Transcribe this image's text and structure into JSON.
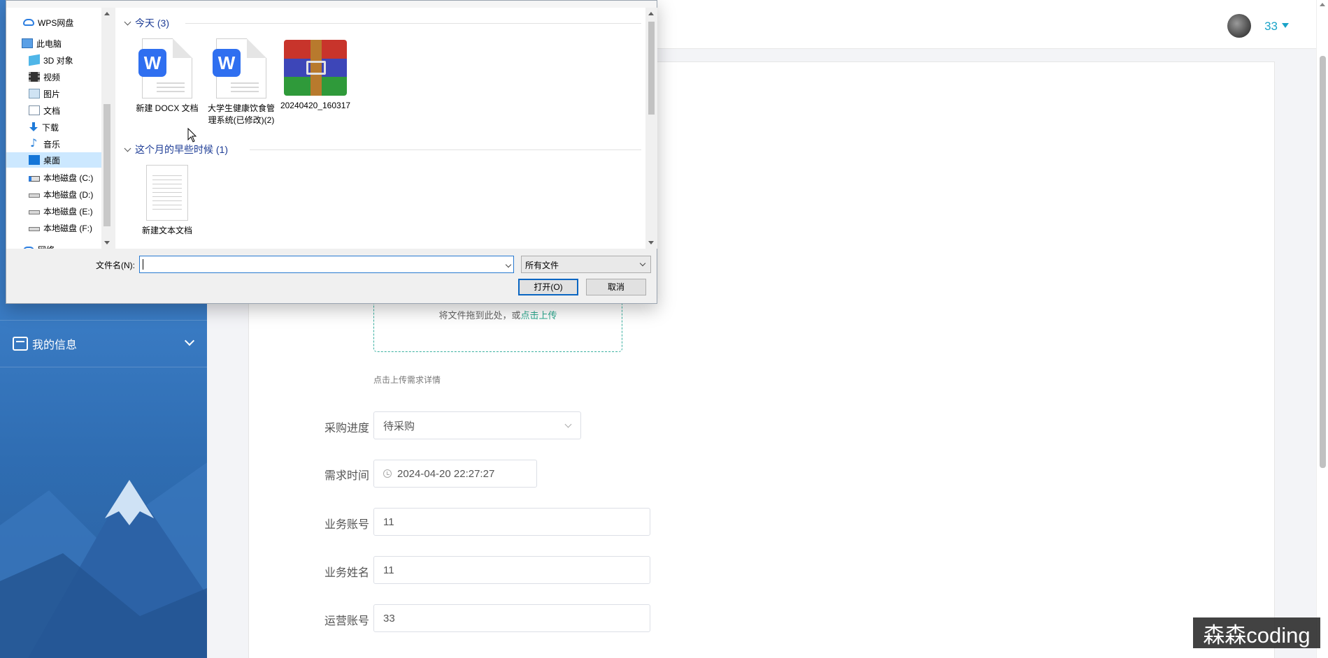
{
  "app": {
    "user": {
      "name": "33"
    },
    "sidebar": {
      "menu": [
        {
          "label": "我的信息"
        }
      ]
    },
    "form": {
      "upload": {
        "drag_text": "将文件拖到此处，或",
        "link_text": "点击上传",
        "tip": "点击上传需求详情"
      },
      "fields": [
        {
          "label": "采购进度",
          "value": "待采购",
          "type": "select"
        },
        {
          "label": "需求时间",
          "value": "2024-04-20 22:27:27",
          "type": "datetime"
        },
        {
          "label": "业务账号",
          "value": "11",
          "type": "text"
        },
        {
          "label": "业务姓名",
          "value": "11",
          "type": "text"
        },
        {
          "label": "运营账号",
          "value": "33",
          "type": "text"
        }
      ]
    },
    "watermark": "森森coding"
  },
  "dialog": {
    "nav": [
      {
        "label": "WPS网盘",
        "icon": "cloud-icon"
      },
      {
        "label": "此电脑",
        "icon": "computer-icon"
      },
      {
        "label": "3D 对象",
        "icon": "cube-icon"
      },
      {
        "label": "视频",
        "icon": "video-icon"
      },
      {
        "label": "图片",
        "icon": "picture-icon"
      },
      {
        "label": "文档",
        "icon": "document-icon"
      },
      {
        "label": "下载",
        "icon": "download-icon"
      },
      {
        "label": "音乐",
        "icon": "music-icon"
      },
      {
        "label": "桌面",
        "icon": "desktop-icon",
        "selected": true
      },
      {
        "label": "本地磁盘 (C:)",
        "icon": "system-disk-icon"
      },
      {
        "label": "本地磁盘 (D:)",
        "icon": "disk-icon"
      },
      {
        "label": "本地磁盘 (E:)",
        "icon": "disk-icon"
      },
      {
        "label": "本地磁盘 (F:)",
        "icon": "disk-icon"
      },
      {
        "label": "网络",
        "icon": "network-icon"
      }
    ],
    "groups": [
      {
        "header": "今天 (3)",
        "files": [
          {
            "name": "新建 DOCX 文档",
            "type": "word"
          },
          {
            "name": "大学生健康饮食管理系统(已修改)(2)",
            "type": "word"
          },
          {
            "name": "20240420_160317",
            "type": "rar"
          }
        ]
      },
      {
        "header": "这个月的早些时候 (1)",
        "files": [
          {
            "name": "新建文本文档",
            "type": "txt"
          }
        ]
      }
    ],
    "filename_label": "文件名(N):",
    "filename_value": "",
    "filter": "所有文件",
    "open_label": "打开(O)",
    "cancel_label": "取消"
  },
  "colors": {
    "accent": "#1aa3c8",
    "upload_link": "#2aa88e",
    "dialog_selection": "#cce8ff",
    "sidebar": "#3b7dc6"
  }
}
